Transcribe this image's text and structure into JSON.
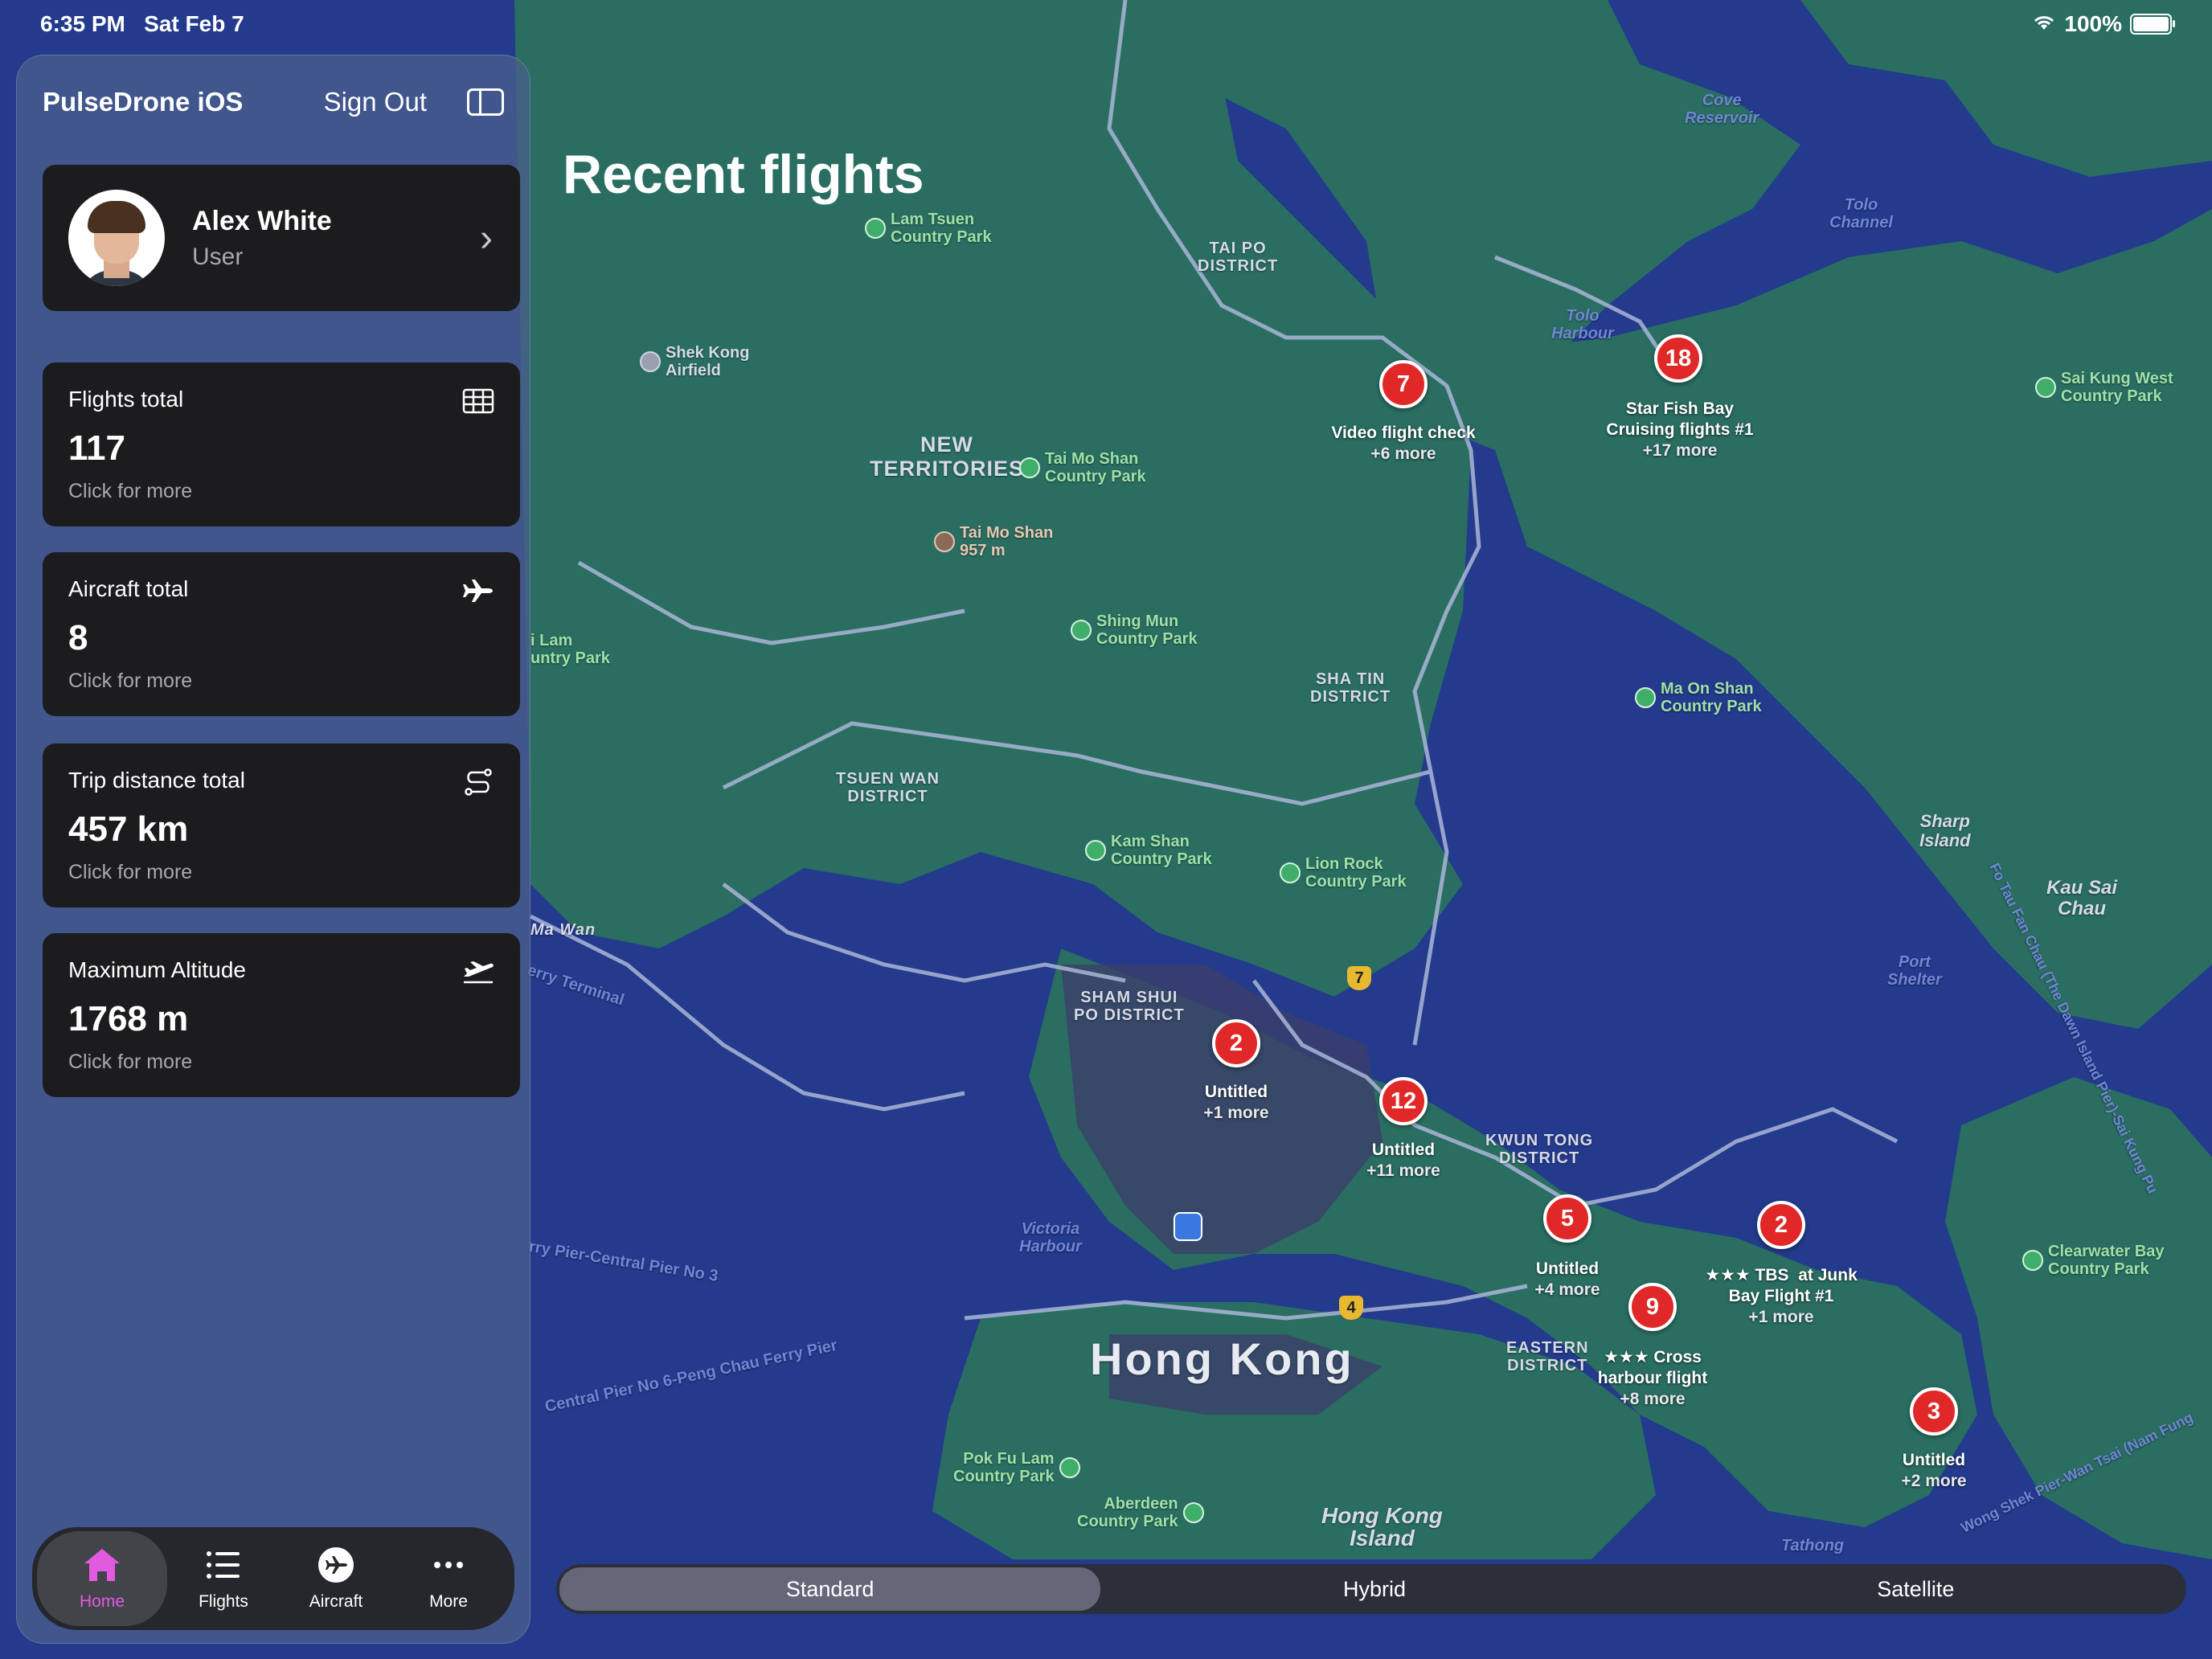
{
  "status_bar": {
    "time": "6:35 PM",
    "date": "Sat Feb 7",
    "battery": "100%"
  },
  "sidebar": {
    "app_title": "PulseDrone iOS",
    "sign_out": "Sign Out",
    "profile": {
      "name": "Alex White",
      "role": "User"
    },
    "stats": [
      {
        "title": "Flights total",
        "value": "117",
        "sub": "Click for more",
        "icon": "table-icon"
      },
      {
        "title": "Aircraft total",
        "value": "8",
        "sub": "Click for more",
        "icon": "airplane-icon"
      },
      {
        "title": "Trip distance total",
        "value": "457 km",
        "sub": "Click for more",
        "icon": "route-icon"
      },
      {
        "title": "Maximum Altitude",
        "value": "1768 m",
        "sub": "Click for more",
        "icon": "takeoff-icon"
      }
    ],
    "tabs": [
      {
        "label": "Home",
        "icon": "home-icon",
        "active": true
      },
      {
        "label": "Flights",
        "icon": "list-icon",
        "active": false
      },
      {
        "label": "Aircraft",
        "icon": "aircraft-icon",
        "active": false
      },
      {
        "label": "More",
        "icon": "ellipsis-icon",
        "active": false
      }
    ],
    "accent_color": "#e05be0"
  },
  "main": {
    "title": "Recent flights",
    "map_types": [
      "Standard",
      "Hybrid",
      "Satellite"
    ],
    "map_type_selected": "Standard"
  },
  "clusters": [
    {
      "count": "7",
      "label": "Video flight check",
      "more": "+6 more"
    },
    {
      "count": "18",
      "label": "Star Fish Bay\nCruising flights #1",
      "more": "+17 more"
    },
    {
      "count": "2",
      "label": "Untitled",
      "more": "+1 more"
    },
    {
      "count": "12",
      "label": "Untitled",
      "more": "+11 more"
    },
    {
      "count": "5",
      "label": "Untitled",
      "more": "+4 more"
    },
    {
      "count": "9",
      "label": "★★★ Cross\nharbour flight",
      "more": "+8 more"
    },
    {
      "count": "2",
      "label": "★★★ TBS  at Junk\nBay Flight #1",
      "more": "+1 more"
    },
    {
      "count": "3",
      "label": "Untitled",
      "more": "+2 more"
    }
  ],
  "map_labels": {
    "lam_tsuen": "Lam Tsuen\nCountry Park",
    "shek_kong": "Shek Kong\nAirfield",
    "tai_po": "TAI PO\nDISTRICT",
    "new_territories": "NEW\nTERRITORIES",
    "tai_mo_shan_park": "Tai Mo Shan\nCountry Park",
    "tai_mo_shan_peak": "Tai Mo Shan\n957 m",
    "shing_mun": "Shing Mun\nCountry Park",
    "sha_tin": "SHA TIN\nDISTRICT",
    "ma_on_shan": "Ma On Shan\nCountry Park",
    "sai_kung_west": "Sai Kung West\nCountry Park",
    "tsuen_wan": "TSUEN WAN\nDISTRICT",
    "kam_shan": "Kam Shan\nCountry Park",
    "lion_rock": "Lion Rock\nCountry Park",
    "sham_shui_po": "SHAM SHUI\nPO DISTRICT",
    "kwun_tong": "KWUN TONG\nDISTRICT",
    "eastern": "EASTERN\nDISTRICT",
    "hong_kong": "Hong Kong",
    "hong_kong_island": "Hong Kong\nIsland",
    "pok_fu_lam": "Pok Fu Lam\nCountry Park",
    "aberdeen": "Aberdeen\nCountry Park",
    "clearwater_bay": "Clearwater Bay\nCountry Park",
    "sharp_island": "Sharp\nIsland",
    "kau_sai_chau": "Kau Sai\nChau",
    "cove_reservoir": "Cove\nReservoir",
    "tolo_channel": "Tolo\nChannel",
    "tolo_harbour": "Tolo\nHarbour",
    "port_shelter": "Port\nShelter",
    "victoria_harbour": "Victoria\nHarbour",
    "ferry_pier": "rry Pier-Central Pier No 3",
    "central_pier": "Central Pier No 6-Peng Chau Ferry Pier",
    "ferry_terminal": "erry Terminal",
    "ma_wan": "Ma Wan",
    "tai_lam": "i Lam\nuntry Park",
    "fo_tau": "Fo Tau Fan Chau (The Dawn Island Pier)-Sai Kung Pu",
    "wong_shek": "Wong Shek Pier-Wan Tsai (Nam Fung",
    "tathong": "Tathong",
    "route_7": "7",
    "route_4": "4"
  }
}
